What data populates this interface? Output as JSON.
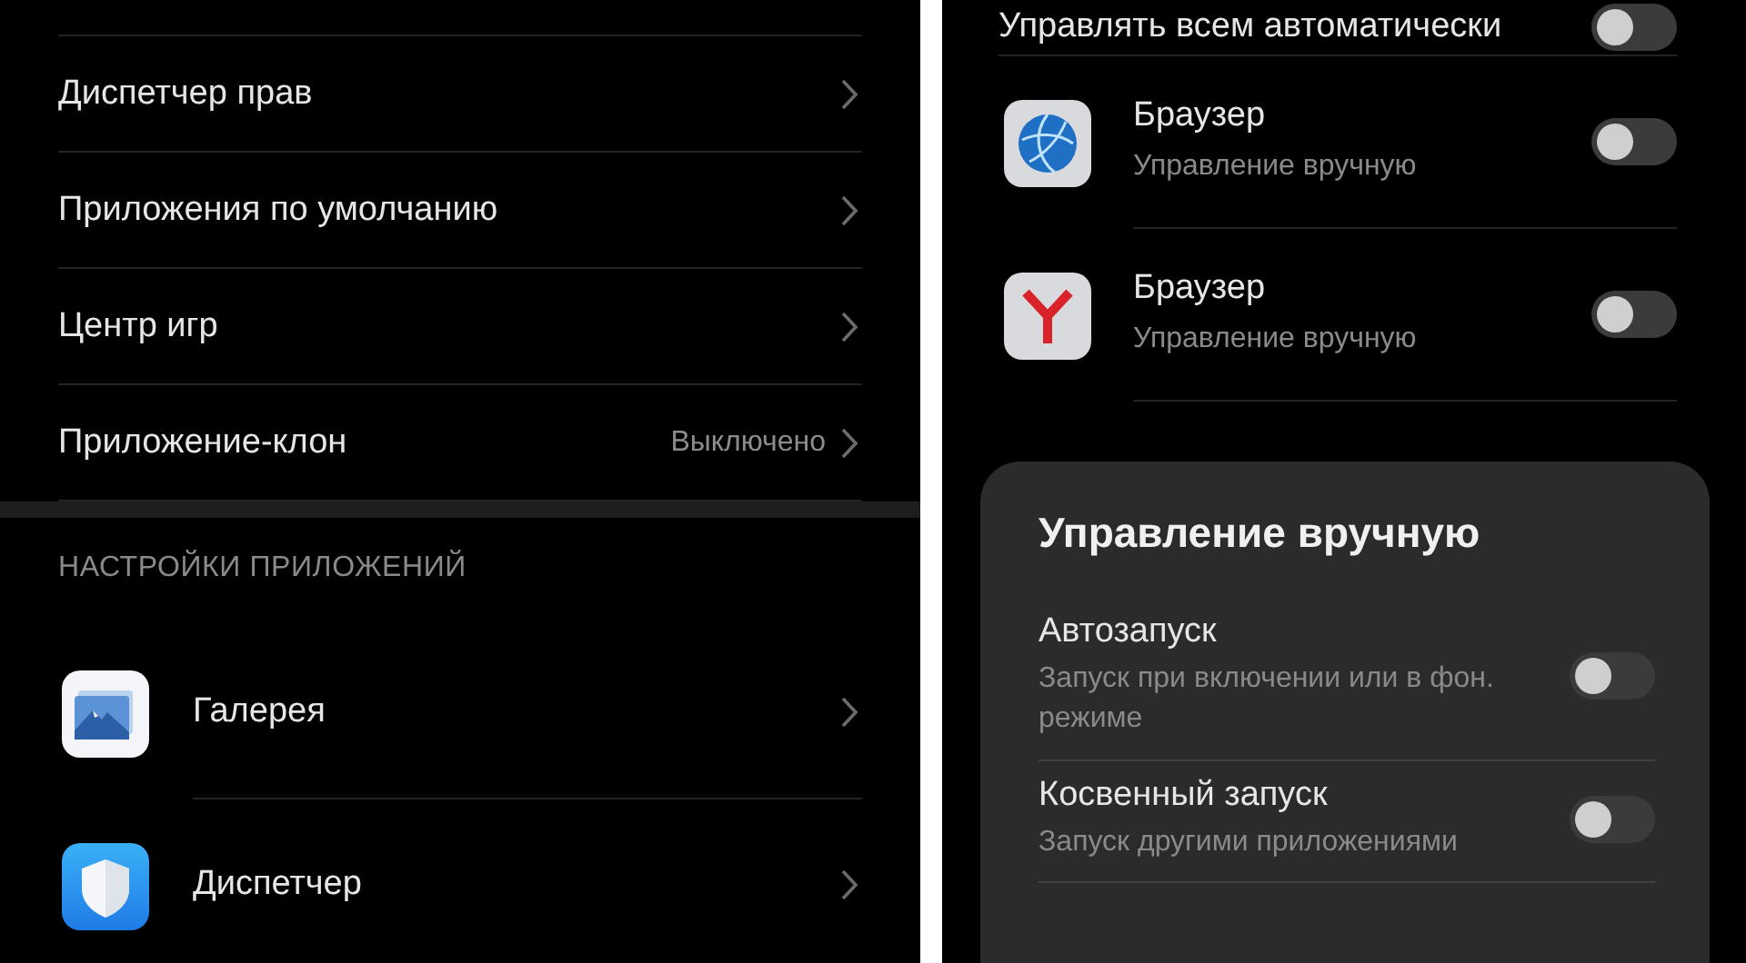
{
  "left_screen": {
    "menu": [
      {
        "label": "Диспетчер прав"
      },
      {
        "label": "Приложения по умолчанию"
      },
      {
        "label": "Центр игр"
      },
      {
        "label": "Приложение-клон",
        "value": "Выключено"
      }
    ],
    "section_header": "НАСТРОЙКИ ПРИЛОЖЕНИЙ",
    "apps": [
      {
        "name": "Галерея"
      },
      {
        "name": "Диспетчер"
      }
    ]
  },
  "right_screen": {
    "manage_all": {
      "label": "Управлять всем автоматически",
      "on": false
    },
    "apps": [
      {
        "name": "Браузер",
        "status": "Управление вручную",
        "on": false
      },
      {
        "name": "Браузер",
        "status": "Управление вручную",
        "on": false
      }
    ],
    "sheet": {
      "title": "Управление вручную",
      "options": [
        {
          "label": "Автозапуск",
          "description": "Запуск при включении или в фон. режиме",
          "on": false
        },
        {
          "label": "Косвенный запуск",
          "description": "Запуск другими приложениями",
          "on": false
        }
      ]
    }
  }
}
